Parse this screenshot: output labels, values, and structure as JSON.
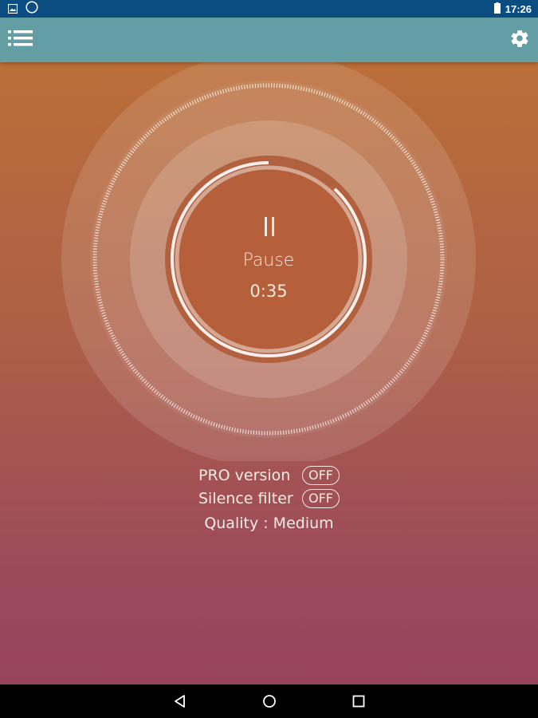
{
  "status_bar": {
    "time": "17:26",
    "icons": [
      "image-notification-icon",
      "circle-notification-icon",
      "battery-icon"
    ]
  },
  "app_bar": {
    "menu_icon": "list-menu-icon",
    "settings_icon": "gear-icon",
    "color": "#649ea5"
  },
  "player": {
    "state_label": "Pause",
    "elapsed": "0:35",
    "progress": 0.12,
    "icon": "pause-icon"
  },
  "settings": {
    "pro_label": "PRO version",
    "pro_value": "OFF",
    "silence_label": "Silence filter",
    "silence_value": "OFF",
    "quality_text": "Quality : Medium"
  },
  "nav_bar": {
    "icons": [
      "back-icon",
      "home-icon",
      "recents-icon"
    ]
  },
  "colors": {
    "status_bar": "#0b4d80",
    "gradient_top": "#bb6e38",
    "gradient_bottom": "#97435e",
    "text": "#f5ebe6"
  }
}
